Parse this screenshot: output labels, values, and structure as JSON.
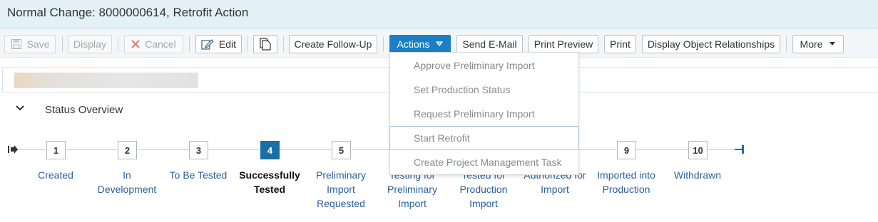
{
  "window": {
    "title": "Normal Change: 8000000614, Retrofit Action"
  },
  "toolbar": {
    "save": "Save",
    "display": "Display",
    "cancel": "Cancel",
    "edit": "Edit",
    "create_follow_up": "Create Follow-Up",
    "actions": "Actions",
    "send_email": "Send E-Mail",
    "print_preview": "Print Preview",
    "print": "Print",
    "display_object_relationships": "Display Object Relationships",
    "more": "More"
  },
  "actions_menu": {
    "items": [
      "Approve Preliminary Import",
      "Set Production Status",
      "Request Preliminary Import",
      "Start Retrofit",
      "Create Project Management Task"
    ],
    "hovered": "Start Retrofit"
  },
  "status_overview": {
    "title": "Status Overview",
    "current_step": 4,
    "steps": [
      {
        "number": "1",
        "label_lines": [
          "Created"
        ]
      },
      {
        "number": "2",
        "label_lines": [
          "In",
          "Development"
        ]
      },
      {
        "number": "3",
        "label_lines": [
          "To Be Tested"
        ]
      },
      {
        "number": "4",
        "label_lines": [
          "Successfully",
          "Tested"
        ]
      },
      {
        "number": "5",
        "label_lines": [
          "Preliminary",
          "Import",
          "Requested"
        ]
      },
      {
        "number": "",
        "label_lines": [
          "Testing for",
          "Preliminary",
          "Import"
        ]
      },
      {
        "number": "",
        "label_lines": [
          "Tested for",
          "Production",
          "Import"
        ]
      },
      {
        "number": "",
        "label_lines": [
          "Authorized for",
          "Import"
        ]
      },
      {
        "number": "9",
        "label_lines": [
          "Imported into",
          "Production"
        ]
      },
      {
        "number": "10",
        "label_lines": [
          "Withdrawn"
        ]
      }
    ]
  },
  "colors": {
    "accent": "#1a7fc4",
    "active_step": "#1b6ea8",
    "link": "#2b5f9e",
    "header_bg": "#e3f1f6"
  }
}
